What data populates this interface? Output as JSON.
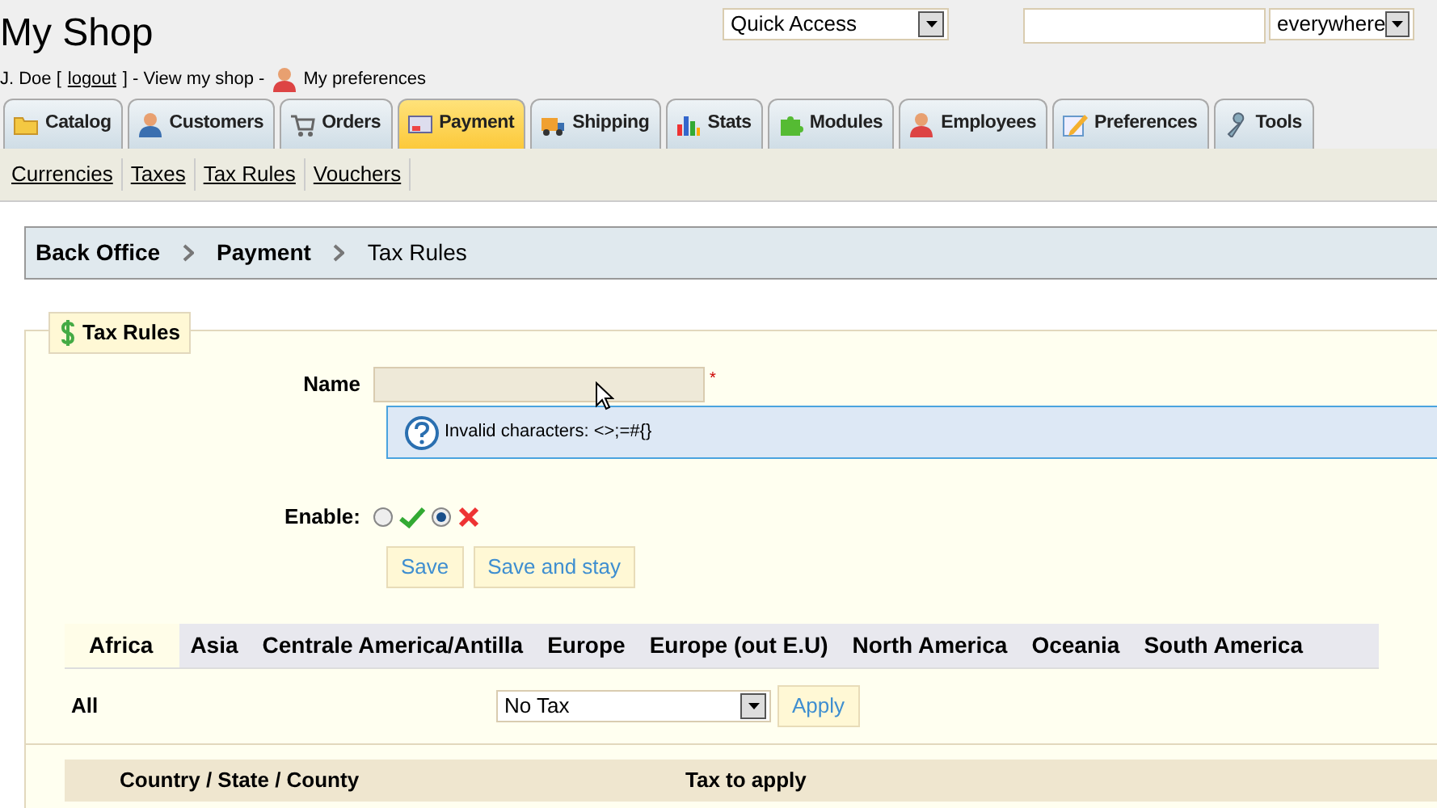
{
  "header": {
    "title": "My Shop",
    "quick_access": "Quick Access",
    "search_scope": "everywhere"
  },
  "user_bar": {
    "name": "J. Doe [",
    "logout": "logout",
    "middle": "] - View my shop -",
    "preferences": "My preferences"
  },
  "tabs": [
    {
      "label": "Catalog",
      "selected": false
    },
    {
      "label": "Customers",
      "selected": false
    },
    {
      "label": "Orders",
      "selected": false
    },
    {
      "label": "Payment",
      "selected": true
    },
    {
      "label": "Shipping",
      "selected": false
    },
    {
      "label": "Stats",
      "selected": false
    },
    {
      "label": "Modules",
      "selected": false
    },
    {
      "label": "Employees",
      "selected": false
    },
    {
      "label": "Preferences",
      "selected": false
    },
    {
      "label": "Tools",
      "selected": false
    }
  ],
  "subtabs": [
    "Currencies",
    "Taxes",
    "Tax Rules",
    "Vouchers"
  ],
  "breadcrumb": [
    "Back Office",
    "Payment",
    "Tax Rules"
  ],
  "form": {
    "legend": "Tax Rules",
    "name_label": "Name",
    "required": "*",
    "hint": "Invalid characters: <>;=#{}",
    "enable_label": "Enable:",
    "enable_options": [
      {
        "kind": "yes",
        "selected": false
      },
      {
        "kind": "no",
        "selected": true
      }
    ],
    "buttons": [
      "Save",
      "Save and stay"
    ]
  },
  "zones": [
    {
      "label": "Africa",
      "selected": true
    },
    {
      "label": "Asia",
      "selected": false
    },
    {
      "label": "Centrale America/Antilla",
      "selected": false
    },
    {
      "label": "Europe",
      "selected": false
    },
    {
      "label": "Europe (out E.U)",
      "selected": false
    },
    {
      "label": "North America",
      "selected": false
    },
    {
      "label": "Oceania",
      "selected": false
    },
    {
      "label": "South America",
      "selected": false
    }
  ],
  "all_row": {
    "label": "All",
    "tax": "No Tax",
    "apply": "Apply"
  },
  "table": {
    "columns": [
      "Country / State / County",
      "Tax to apply"
    ]
  }
}
